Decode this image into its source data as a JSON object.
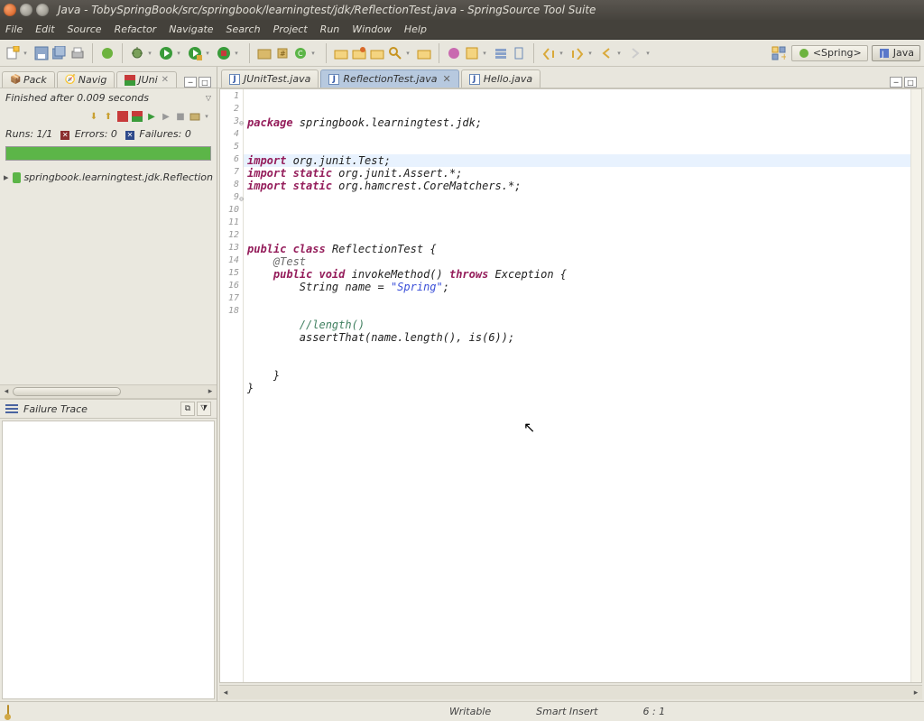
{
  "titlebar": {
    "title": "Java - TobySpringBook/src/springbook/learningtest/jdk/ReflectionTest.java - SpringSource Tool Suite"
  },
  "menubar": [
    "File",
    "Edit",
    "Source",
    "Refactor",
    "Navigate",
    "Search",
    "Project",
    "Run",
    "Window",
    "Help"
  ],
  "perspectives": {
    "spring": "<Spring>",
    "java": "Java"
  },
  "left_tabs": {
    "pack": "Pack",
    "navig": "Navig",
    "junit": "JUni"
  },
  "junit": {
    "status": "Finished after 0.009 seconds",
    "runs_label": "Runs:",
    "runs_value": "1/1",
    "errors_label": "Errors:",
    "errors_value": "0",
    "failures_label": "Failures:",
    "failures_value": "0",
    "tree_item": "springbook.learningtest.jdk.Reflection",
    "failure_trace": "Failure Trace"
  },
  "editor_tabs": {
    "t1": "JUnitTest.java",
    "t2": "ReflectionTest.java",
    "t3": "Hello.java"
  },
  "code": {
    "l1_kw": "package",
    "l1_rest": " springbook.learningtest.jdk;",
    "l3_kw": "import",
    "l3_rest": " org.junit.Test;",
    "l4_kw1": "import",
    "l4_kw2": " static",
    "l4_rest": " org.junit.Assert.*;",
    "l5_kw1": "import",
    "l5_kw2": " static",
    "l5_rest": " org.hamcrest.CoreMatchers.*;",
    "l8_kw1": "public",
    "l8_kw2": " class",
    "l8_rest": " ReflectionTest {",
    "l9": "    @Test",
    "l10_kw1": "    public",
    "l10_kw2": " void",
    "l10_mid": " invokeMethod() ",
    "l10_kw3": "throws",
    "l10_rest": " Exception {",
    "l11_a": "        String name = ",
    "l11_str": "\"Spring\"",
    "l11_b": ";",
    "l13": "        //length()",
    "l14_a": "        ",
    "l14_b": "assertThat",
    "l14_c": "(name.length(), ",
    "l14_d": "is",
    "l14_e": "(6));",
    "l16": "    }",
    "l17": "}"
  },
  "line_numbers": [
    "1",
    "2",
    "3",
    "4",
    "5",
    "6",
    "7",
    "8",
    "9",
    "10",
    "11",
    "12",
    "13",
    "14",
    "15",
    "16",
    "17",
    "18"
  ],
  "statusbar": {
    "writable": "Writable",
    "insert": "Smart Insert",
    "cursor": "6 : 1"
  }
}
